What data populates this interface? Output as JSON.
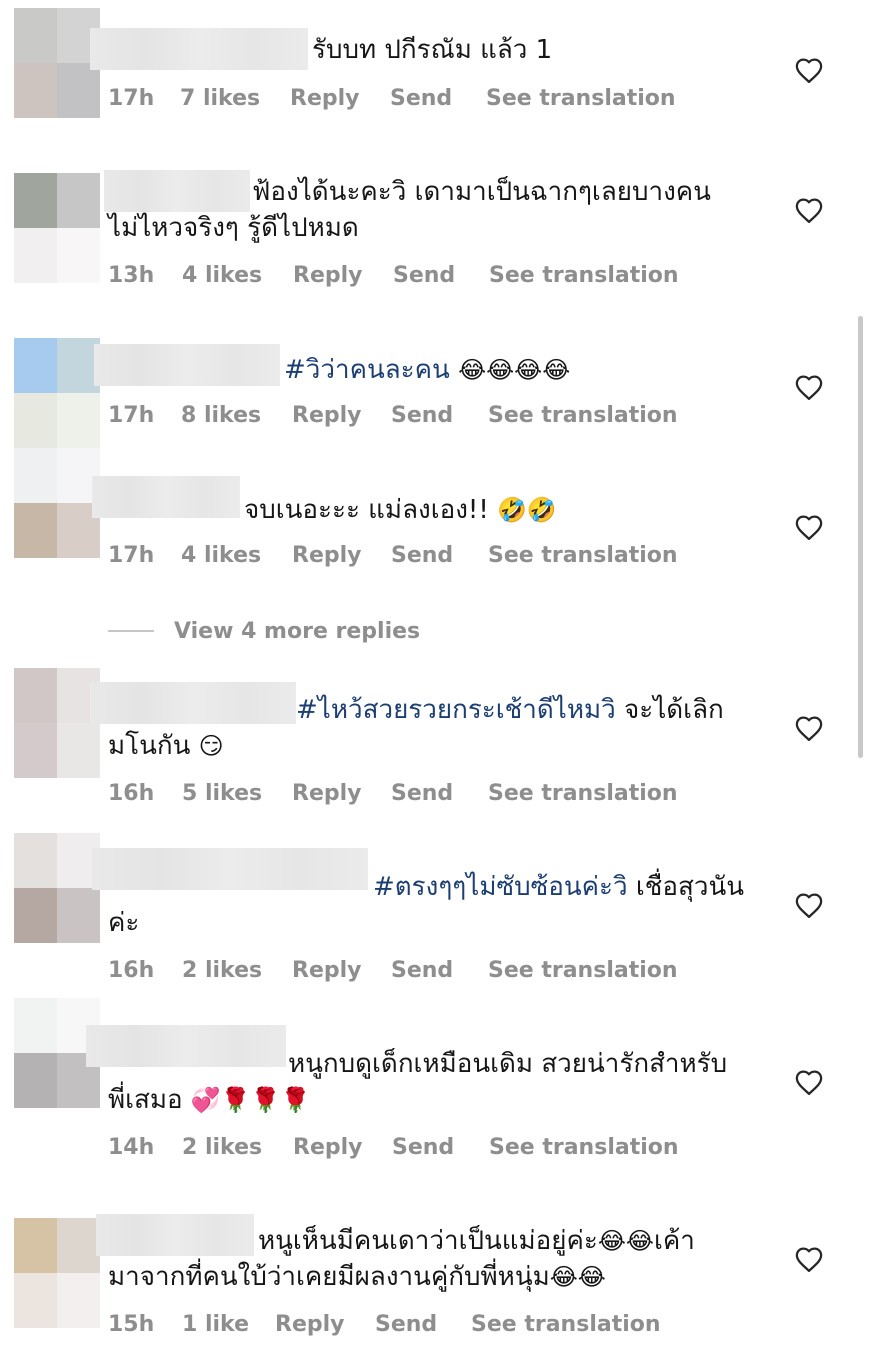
{
  "comments": [
    {
      "text": "รับบท ปกีรณัม แล้ว 1",
      "line2": "",
      "time": "17h",
      "likes": "7 likes",
      "reply": "Reply",
      "send": "Send",
      "translate": "See translation"
    },
    {
      "text": "ฟ้องได้นะคะวิ เดามาเป็นฉากๆเลยบางคน",
      "line2": "ไม่ไหวจริงๆ รู้ดีไปหมด",
      "time": "13h",
      "likes": "4 likes",
      "reply": "Reply",
      "send": "Send",
      "translate": "See translation"
    },
    {
      "hashtag": "#วิว่าคนละคน",
      "emoji": "😂😂😂😂",
      "time": "17h",
      "likes": "8 likes",
      "reply": "Reply",
      "send": "Send",
      "translate": "See translation"
    },
    {
      "text": "จบเนอะะะ แม่ลงเอง!!",
      "emoji": "🤣🤣",
      "time": "17h",
      "likes": "4 likes",
      "reply": "Reply",
      "send": "Send",
      "translate": "See translation"
    },
    {
      "hashtag": "#ไหว้สวยรวยกระเช้าดีไหมวิ",
      "text": "จะได้เลิก",
      "line2": "มโนกัน",
      "emoji": "😏",
      "time": "16h",
      "likes": "5 likes",
      "reply": "Reply",
      "send": "Send",
      "translate": "See translation"
    },
    {
      "hashtag": "#ตรงๆๆไม่ซับซ้อนค่ะวิ",
      "text": "เชื่อสุวนัน",
      "line2": "ค่ะ",
      "time": "16h",
      "likes": "2 likes",
      "reply": "Reply",
      "send": "Send",
      "translate": "See translation"
    },
    {
      "text": "หนูกบดูเด็กเหมือนเดิม สวยน่ารักสำหรับ",
      "line2": "พี่เสมอ",
      "emoji": "💞🌹🌹🌹",
      "time": "14h",
      "likes": "2 likes",
      "reply": "Reply",
      "send": "Send",
      "translate": "See translation"
    },
    {
      "text": "หนูเห็นมีคนเดาว่าเป็นแม่อยู่ค่ะ",
      "emoji": "😂😂",
      "text_b": "เค้า",
      "line2": "มาจากที่คนใบ้ว่าเคยมีผลงานคู่กับพี่หนุ่ม",
      "emoji2": "😂😂",
      "time": "15h",
      "likes": "1 like",
      "reply": "Reply",
      "send": "Send",
      "translate": "See translation"
    }
  ],
  "view_more": "View 4 more replies",
  "icons": {
    "like": "heart-outline-icon"
  },
  "colors": {
    "hashtag": "#1c3e72",
    "meta": "#8e8e8e"
  }
}
